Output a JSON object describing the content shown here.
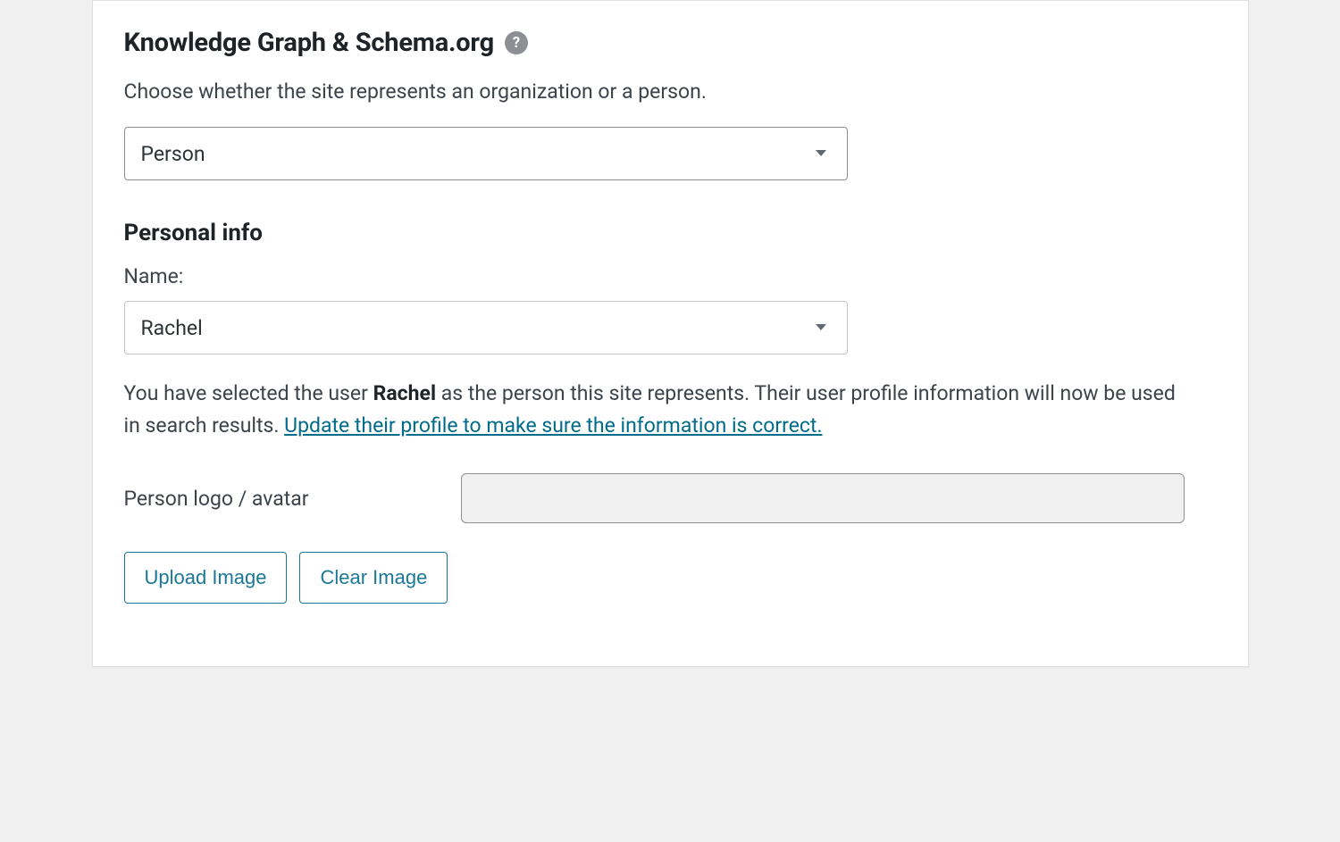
{
  "section": {
    "title": "Knowledge Graph & Schema.org",
    "help_icon": "?",
    "description": "Choose whether the site represents an organization or a person."
  },
  "entity_select": {
    "value": "Person"
  },
  "personal_info": {
    "heading": "Personal info",
    "name_label": "Name:",
    "name_value": "Rachel",
    "info_prefix": "You have selected the user ",
    "info_user": "Rachel",
    "info_suffix": " as the person this site represents. Their user profile information will now be used in search results. ",
    "info_link": "Update their profile to make sure the information is correct."
  },
  "avatar": {
    "label": "Person logo / avatar",
    "value": ""
  },
  "buttons": {
    "upload": "Upload Image",
    "clear": "Clear Image"
  }
}
